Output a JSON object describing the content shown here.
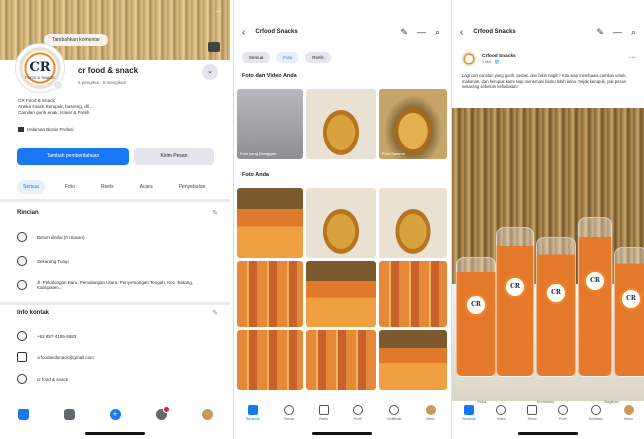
{
  "panel1": {
    "cover_button": "Tambahkan komentar",
    "avatar_text": "CR",
    "avatar_subtext": "FOOD & SNACK",
    "page_name": "cr food & snack",
    "stats": "6 pengikut · 6 mengikuti",
    "bio_lines": [
      "CR Food & Snack",
      "Aneka snack Kerupuk, basreng, dll...",
      "Camilan gurih enak, Kasar & Fresh"
    ],
    "page_badge": "Halaman Bisnis Profesi",
    "primary_button": "Tambah pemberitahuan",
    "secondary_button": "Kirim Pesan",
    "tabs": [
      "Semua",
      "Foto",
      "Reels",
      "Acara",
      "Penyebutan"
    ],
    "tab_active": "Semua",
    "details_title": "Rincian",
    "details": [
      "Belum dinilai (0 Ulasan)",
      "Sekarang Tutup",
      "Jl. Pekalongan Baru, Pemalangan Utara, Penyemangan Tengah, Kec. Batang, Kabupaten..."
    ],
    "contact_title": "Info kontak",
    "contacts": [
      "+62 857-4155-5883",
      "crfoodandsnack@gmail.com",
      "cr food & snack"
    ]
  },
  "panel2": {
    "title": "Crfood Snacks",
    "tabs": [
      "Semua",
      "Foto",
      "Reels"
    ],
    "tab_active": "Foto",
    "section1": "Foto dan Video Anda",
    "section1_captions": [
      "Foto yang Diunggah",
      "",
      "Foto Sampul"
    ],
    "section2": "Foto Anda",
    "nav": [
      "Beranda",
      "Teman",
      "Reels",
      "Profil",
      "Notifikasi",
      "Menu"
    ]
  },
  "panel3": {
    "title": "Crfood Snacks",
    "post_name": "Crfood Snacks",
    "post_time": "1 Mei · 🌐",
    "post_text": "Lagi cari camilan yang gurih, pedas, dan bikin nagih? Kita siap membawa camilan untuk, makanan, dan kerupuk kami siap menemani kamu lebih lama. Sejak kerupuk, yuk pesan sekarang sebelum kehabisan!",
    "reactions": [
      "Suka",
      "Komentar",
      "Bagikan"
    ],
    "jar_label": "CR",
    "nav": [
      "Beranda",
      "Video",
      "Reels",
      "Profil",
      "Notifikasi",
      "Menu"
    ]
  },
  "colors": {
    "accent": "#1877f2",
    "notification": "#e41e3f",
    "orange": "#f08a2a"
  },
  "icons": {
    "p1_nav": [
      "home-icon",
      "marketplace-icon",
      "create-icon",
      "notifications-icon",
      "profile-avatar-icon"
    ],
    "header_actions": [
      "edit-icon",
      "more-icon",
      "search-icon"
    ]
  }
}
